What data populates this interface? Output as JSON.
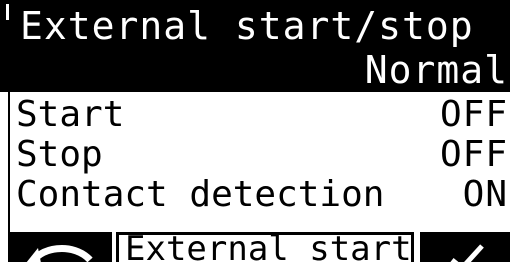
{
  "header": {
    "title": "External start/stop",
    "mode": "Normal"
  },
  "rows": [
    {
      "label": "Start",
      "value": "OFF"
    },
    {
      "label": "Stop",
      "value": "OFF"
    },
    {
      "label": "Contact detection",
      "value": "ON"
    }
  ],
  "softkeys": {
    "middle_label": "External start/"
  },
  "icons": {
    "back": "back-arrow-icon",
    "confirm": "checkmark-icon"
  }
}
